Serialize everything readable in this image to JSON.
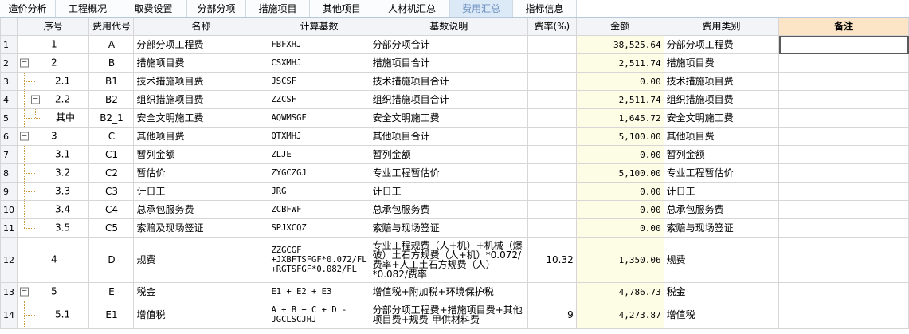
{
  "tabs": [
    {
      "label": "造价分析"
    },
    {
      "label": "工程概况"
    },
    {
      "label": "取费设置"
    },
    {
      "label": "分部分项"
    },
    {
      "label": "措施项目"
    },
    {
      "label": "其他项目"
    },
    {
      "label": "人材机汇总"
    },
    {
      "label": "费用汇总",
      "active": true
    },
    {
      "label": "指标信息"
    }
  ],
  "columns": {
    "seq": "序号",
    "code": "费用代号",
    "name": "名称",
    "base": "计算基数",
    "desc": "基数说明",
    "rate": "费率(%)",
    "amount": "金额",
    "type": "费用类别",
    "note": "备注"
  },
  "rows": [
    {
      "rn": "1",
      "seq": "1",
      "code": "A",
      "name": "分部分项工程费",
      "base": "FBFXHJ",
      "desc": "分部分项合计",
      "rate": "",
      "amount": "38,525.64",
      "type": "分部分项工程费"
    },
    {
      "rn": "2",
      "seq": "2",
      "code": "B",
      "name": "措施项目费",
      "base": "CSXMHJ",
      "desc": "措施项目合计",
      "rate": "",
      "amount": "2,511.74",
      "type": "措施项目费"
    },
    {
      "rn": "3",
      "seq": "2.1",
      "code": "B1",
      "name": "技术措施项目费",
      "base": "JSCSF",
      "desc": "技术措施项目合计",
      "rate": "",
      "amount": "0.00",
      "type": "技术措施项目费"
    },
    {
      "rn": "4",
      "seq": "2.2",
      "code": "B2",
      "name": "组织措施项目费",
      "base": "ZZCSF",
      "desc": "组织措施项目合计",
      "rate": "",
      "amount": "2,511.74",
      "type": "组织措施项目费"
    },
    {
      "rn": "5",
      "seq": "其中",
      "code": "B2_1",
      "name": "安全文明施工费",
      "base": "AQWMSGF",
      "desc": "安全文明施工费",
      "rate": "",
      "amount": "1,645.72",
      "type": "安全文明施工费"
    },
    {
      "rn": "6",
      "seq": "3",
      "code": "C",
      "name": "其他项目费",
      "base": "QTXMHJ",
      "desc": "其他项目合计",
      "rate": "",
      "amount": "5,100.00",
      "type": "其他项目费"
    },
    {
      "rn": "7",
      "seq": "3.1",
      "code": "C1",
      "name": "暂列金额",
      "base": "ZLJE",
      "desc": "暂列金额",
      "rate": "",
      "amount": "0.00",
      "type": "暂列金额"
    },
    {
      "rn": "8",
      "seq": "3.2",
      "code": "C2",
      "name": "暂估价",
      "base": "ZYGCZGJ",
      "desc": "专业工程暂估价",
      "rate": "",
      "amount": "5,100.00",
      "type": "专业工程暂估价"
    },
    {
      "rn": "9",
      "seq": "3.3",
      "code": "C3",
      "name": "计日工",
      "base": "JRG",
      "desc": "计日工",
      "rate": "",
      "amount": "0.00",
      "type": "计日工"
    },
    {
      "rn": "10",
      "seq": "3.4",
      "code": "C4",
      "name": "总承包服务费",
      "base": "ZCBFWF",
      "desc": "总承包服务费",
      "rate": "",
      "amount": "0.00",
      "type": "总承包服务费"
    },
    {
      "rn": "11",
      "seq": "3.5",
      "code": "C5",
      "name": "索赔及现场签证",
      "base": "SPJXCQZ",
      "desc": "索赔与现场签证",
      "rate": "",
      "amount": "0.00",
      "type": "索赔与现场签证"
    },
    {
      "rn": "12",
      "seq": "4",
      "code": "D",
      "name": "规费",
      "base": "ZZGCGF\n+JXBFTSFGF*0.072/FL\n+RGTSFGF*0.082/FL",
      "desc": "专业工程规费（人+机）+机械（爆破）土石方规费（人+机）*0.072/费率+人工土石方规费（人）*0.082/费率",
      "rate": "10.32",
      "amount": "1,350.06",
      "type": "规费"
    },
    {
      "rn": "13",
      "seq": "5",
      "code": "E",
      "name": "税金",
      "base": "E1 + E2 + E3",
      "desc": "增值税+附加税+环境保护税",
      "rate": "",
      "amount": "4,786.73",
      "type": "税金"
    },
    {
      "rn": "14",
      "seq": "5.1",
      "code": "E1",
      "name": "增值税",
      "base": "A + B + C + D -\nJGCLSCJHJ",
      "desc": "分部分项工程费+措施项目费+其他项目费+规费-甲供材料费",
      "rate": "9",
      "amount": "4,273.87",
      "type": "增值税"
    }
  ],
  "icons": {
    "expand": "minus-toggle-icon"
  }
}
